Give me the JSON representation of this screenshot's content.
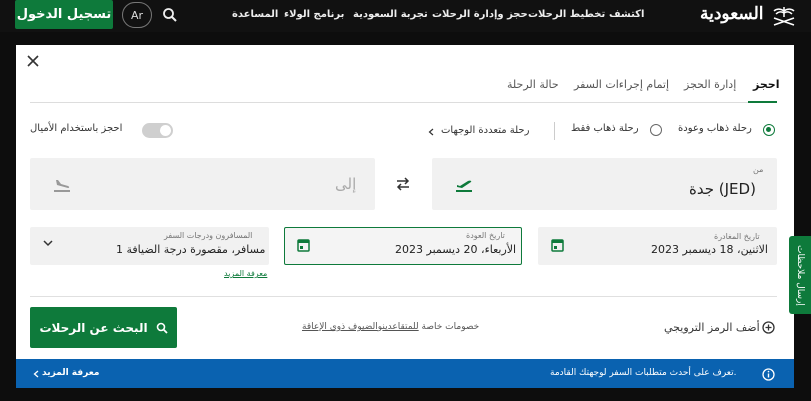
{
  "header": {
    "logo_text": "السعودية",
    "nav": [
      "اكتشف",
      "تخطيط الرحلات",
      "حجز وإدارة الرحلات",
      "تجربة السعودية",
      "برنامج الولاء",
      "المساعدة"
    ],
    "language": "Ar",
    "login_label": "تسجيل الدخول"
  },
  "tabs": [
    "احجز",
    "إدارة الحجز",
    "إتمام إجراءات السفر",
    "حالة الرحلة"
  ],
  "trip_type": {
    "round_trip": "رحلة ذهاب وعودة",
    "one_way": "رحلة ذهاب فقط",
    "multi_city": "رحلة متعددة الوجهات"
  },
  "miles_toggle_label": "احجز باستخدام الأميال",
  "from": {
    "label": "من",
    "value": "جدة (JED)"
  },
  "to": {
    "placeholder": "إلى"
  },
  "departure": {
    "label": "تاريخ المغادرة",
    "value": "الاثنين، 18 ديسمبر 2023"
  },
  "return": {
    "label": "تاريخ العودة",
    "value": "الأربعاء، 20 ديسمبر 2023"
  },
  "passengers": {
    "label": "المسافرون ودرجات السفر",
    "value": "1 مسافر، مقصورة درجة الضيافة",
    "more_link": "معرفة المزيد"
  },
  "promo_label": "أضف الرمز الترويجي",
  "discounts": {
    "prefix": "خصومات خاصة",
    "seniors": "للمتقاعدين",
    "and": "و",
    "disabled": "الضيوف ذوي الإعاقة"
  },
  "search_button": "البحث عن الرحلات",
  "banner": {
    "text": "تعرف على أحدث متطلبات السفر لوجهتك القادمة.",
    "link": "معرفة المزيد"
  },
  "feedback_tab": "إرسال ملاحظات",
  "colors": {
    "brand_green": "#0e7a3b",
    "banner_blue": "#0a62b0",
    "topbar": "#111111"
  }
}
